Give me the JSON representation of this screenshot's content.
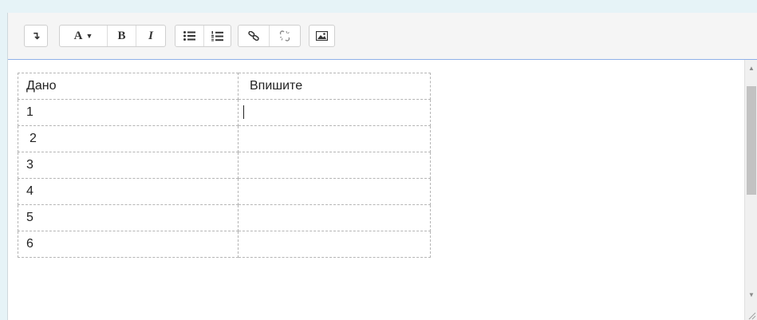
{
  "toolbar": {
    "buttons": [
      {
        "name": "collapse-toolbar-button",
        "icon": "arrow-down-icon",
        "glyph": "↴"
      },
      {
        "name": "text-style-button",
        "icon": "font-style-icon",
        "label": "A"
      },
      {
        "name": "bold-button",
        "icon": "bold-icon",
        "label": "B"
      },
      {
        "name": "italic-button",
        "icon": "italic-icon",
        "label": "I"
      },
      {
        "name": "unordered-list-button",
        "icon": "bullet-list-icon"
      },
      {
        "name": "ordered-list-button",
        "icon": "numbered-list-icon"
      },
      {
        "name": "link-button",
        "icon": "link-icon"
      },
      {
        "name": "unlink-button",
        "icon": "unlink-icon"
      },
      {
        "name": "insert-image-button",
        "icon": "image-icon"
      }
    ]
  },
  "table": {
    "header": {
      "col1": "Дано",
      "col2": "Впишите"
    },
    "rows": [
      {
        "col1": "1",
        "col2": ""
      },
      {
        "col1": "2",
        "col2": ""
      },
      {
        "col1": "3",
        "col2": ""
      },
      {
        "col1": "4",
        "col2": ""
      },
      {
        "col1": "5",
        "col2": ""
      },
      {
        "col1": "6",
        "col2": ""
      }
    ]
  },
  "colors": {
    "page_background": "#e6f3f7",
    "toolbar_background": "#f5f5f5",
    "focus_border": "#8fb0e8",
    "grid_border": "#b5b5b5",
    "scrollbar_thumb": "#c2c2c2"
  }
}
